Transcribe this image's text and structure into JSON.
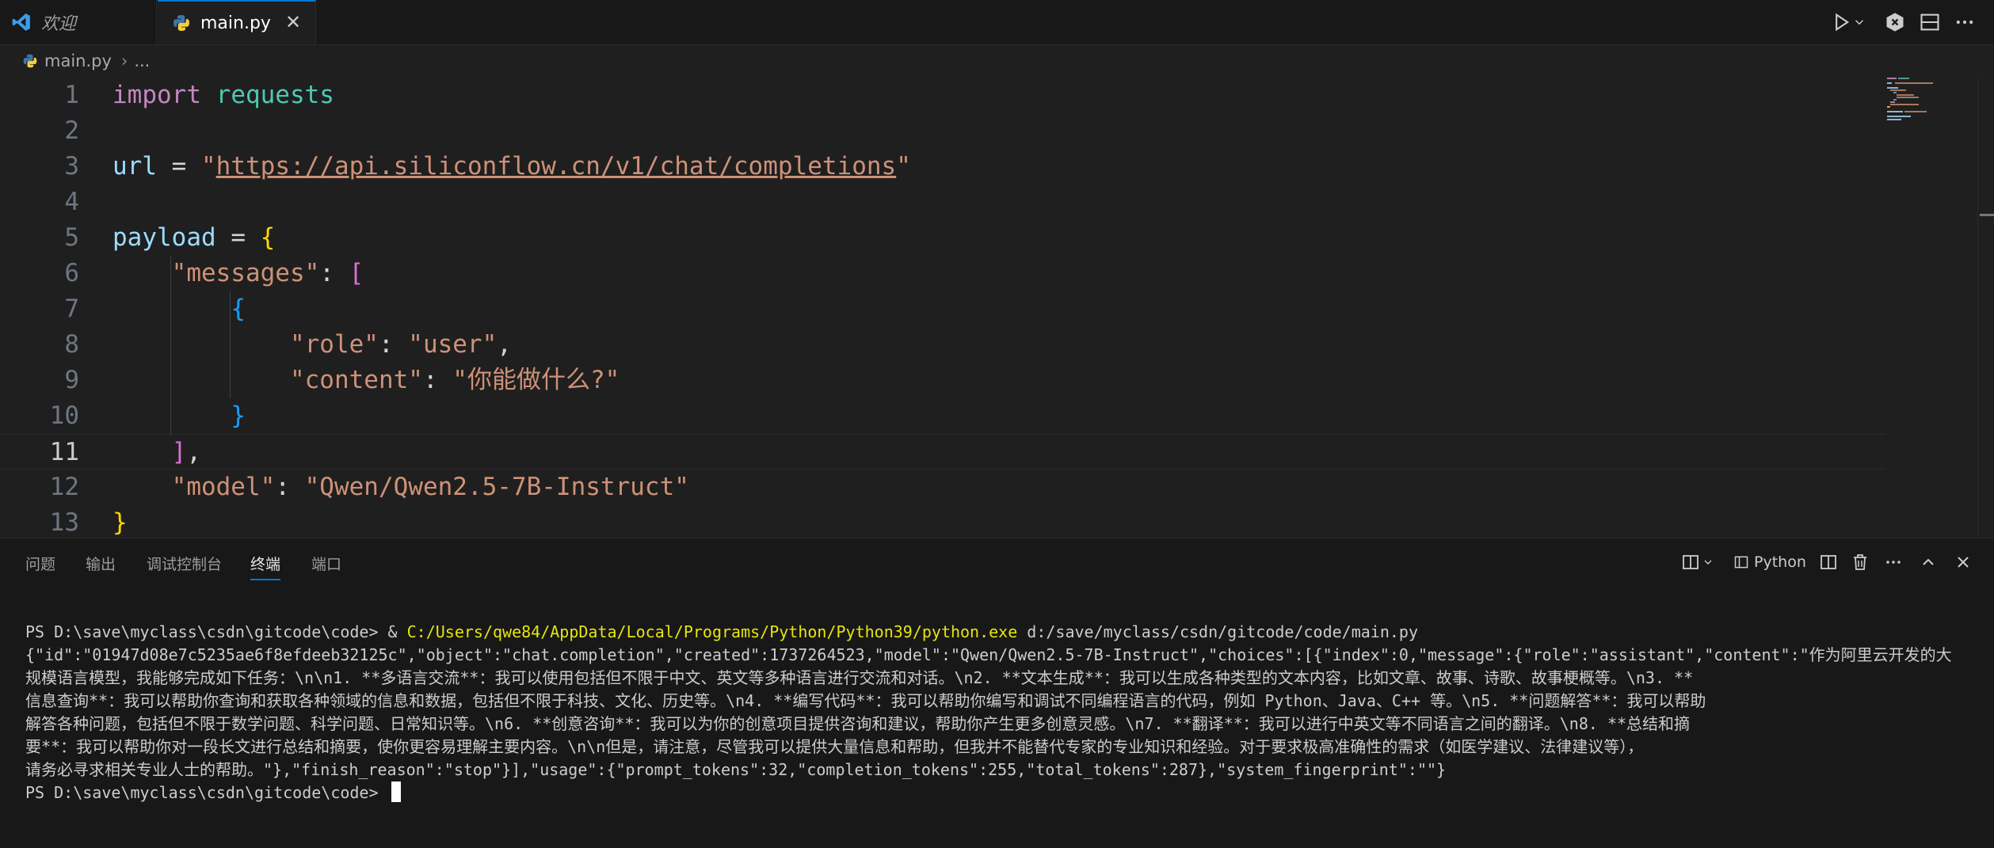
{
  "tabs": [
    {
      "label": "欢迎",
      "icon": "vscode-logo-icon"
    },
    {
      "label": "main.py",
      "icon": "python-file-icon",
      "close": "✕"
    }
  ],
  "breadcrumb": {
    "file": "main.py",
    "sep": "›",
    "rest": "..."
  },
  "editor": {
    "lines": [
      {
        "n": "1",
        "tokens": [
          [
            "kw",
            "import"
          ],
          [
            "op",
            " "
          ],
          [
            "mod",
            "requests"
          ]
        ]
      },
      {
        "n": "2",
        "tokens": []
      },
      {
        "n": "3",
        "tokens": [
          [
            "var",
            "url"
          ],
          [
            "op",
            " = "
          ],
          [
            "str",
            "\""
          ],
          [
            "strurl",
            "https://api.siliconflow.cn/v1/chat/completions"
          ],
          [
            "str",
            "\""
          ]
        ]
      },
      {
        "n": "4",
        "tokens": []
      },
      {
        "n": "5",
        "tokens": [
          [
            "var",
            "payload"
          ],
          [
            "op",
            " = "
          ],
          [
            "brace",
            "{"
          ]
        ]
      },
      {
        "n": "6",
        "tokens": [
          [
            "op",
            "    "
          ],
          [
            "str",
            "\"messages\""
          ],
          [
            "op",
            ": "
          ],
          [
            "bracket",
            "["
          ]
        ]
      },
      {
        "n": "7",
        "tokens": [
          [
            "op",
            "        "
          ],
          [
            "brace2",
            "{"
          ]
        ]
      },
      {
        "n": "8",
        "tokens": [
          [
            "op",
            "            "
          ],
          [
            "str",
            "\"role\""
          ],
          [
            "op",
            ": "
          ],
          [
            "str",
            "\"user\""
          ],
          [
            "op",
            ","
          ]
        ]
      },
      {
        "n": "9",
        "tokens": [
          [
            "op",
            "            "
          ],
          [
            "str",
            "\"content\""
          ],
          [
            "op",
            ": "
          ],
          [
            "str",
            "\"你能做什么?\""
          ]
        ]
      },
      {
        "n": "10",
        "tokens": [
          [
            "op",
            "        "
          ],
          [
            "brace2",
            "}"
          ]
        ]
      },
      {
        "n": "11",
        "tokens": [
          [
            "op",
            "    "
          ],
          [
            "bracket",
            "]"
          ],
          [
            "op",
            ","
          ]
        ],
        "current": true
      },
      {
        "n": "12",
        "tokens": [
          [
            "op",
            "    "
          ],
          [
            "str",
            "\"model\""
          ],
          [
            "op",
            ": "
          ],
          [
            "str",
            "\"Qwen/Qwen2.5-7B-Instruct\""
          ]
        ]
      },
      {
        "n": "13",
        "tokens": [
          [
            "brace",
            "}"
          ]
        ]
      }
    ]
  },
  "panel": {
    "tabs": [
      "问题",
      "输出",
      "调试控制台",
      "终端",
      "端口"
    ],
    "active_tab": "终端",
    "terminal_profile": "Python"
  },
  "terminal": {
    "prompt": "PS D:\\save\\myclass\\csdn\\gitcode\\code> & ",
    "exe": "C:/Users/qwe84/AppData/Local/Programs/Python/Python39/python.exe",
    "script": " d:/save/myclass/csdn/gitcode/code/main.py",
    "output": [
      "{\"id\":\"01947d08e7c5235ae6f8efdeeb32125c\",\"object\":\"chat.completion\",\"created\":1737264523,\"model\":\"Qwen/Qwen2.5-7B-Instruct\",\"choices\":[{\"index\":0,\"message\":{\"role\":\"assistant\",\"content\":\"作为阿里云开发的大",
      "规模语言模型，我能够完成如下任务：\\n\\n1. **多语言交流**：我可以使用包括但不限于中文、英文等多种语言进行交流和对话。\\n2. **文本生成**：我可以生成各种类型的文本内容，比如文章、故事、诗歌、故事梗概等。\\n3. **",
      "信息查询**：我可以帮助你查询和获取各种领域的信息和数据，包括但不限于科技、文化、历史等。\\n4. **编写代码**：我可以帮助你编写和调试不同编程语言的代码，例如 Python、Java、C++ 等。\\n5. **问题解答**：我可以帮助",
      "解答各种问题，包括但不限于数学问题、科学问题、日常知识等。\\n6. **创意咨询**：我可以为你的创意项目提供咨询和建议，帮助你产生更多创意灵感。\\n7. **翻译**：我可以进行中英文等不同语言之间的翻译。\\n8. **总结和摘",
      "要**：我可以帮助你对一段长文进行总结和摘要，使你更容易理解主要内容。\\n\\n但是，请注意，尽管我可以提供大量信息和帮助，但我并不能替代专家的专业知识和经验。对于要求极高准确性的需求（如医学建议、法律建议等），",
      "请务必寻求相关专业人士的帮助。\"},\"finish_reason\":\"stop\"}],\"usage\":{\"prompt_tokens\":32,\"completion_tokens\":255,\"total_tokens\":287},\"system_fingerprint\":\"\"}"
    ],
    "final_prompt": "PS D:\\save\\myclass\\csdn\\gitcode\\code> "
  },
  "colors": {
    "accent": "#0078d4",
    "editor_bg": "#1f1f1f",
    "panel_bg": "#181818"
  }
}
